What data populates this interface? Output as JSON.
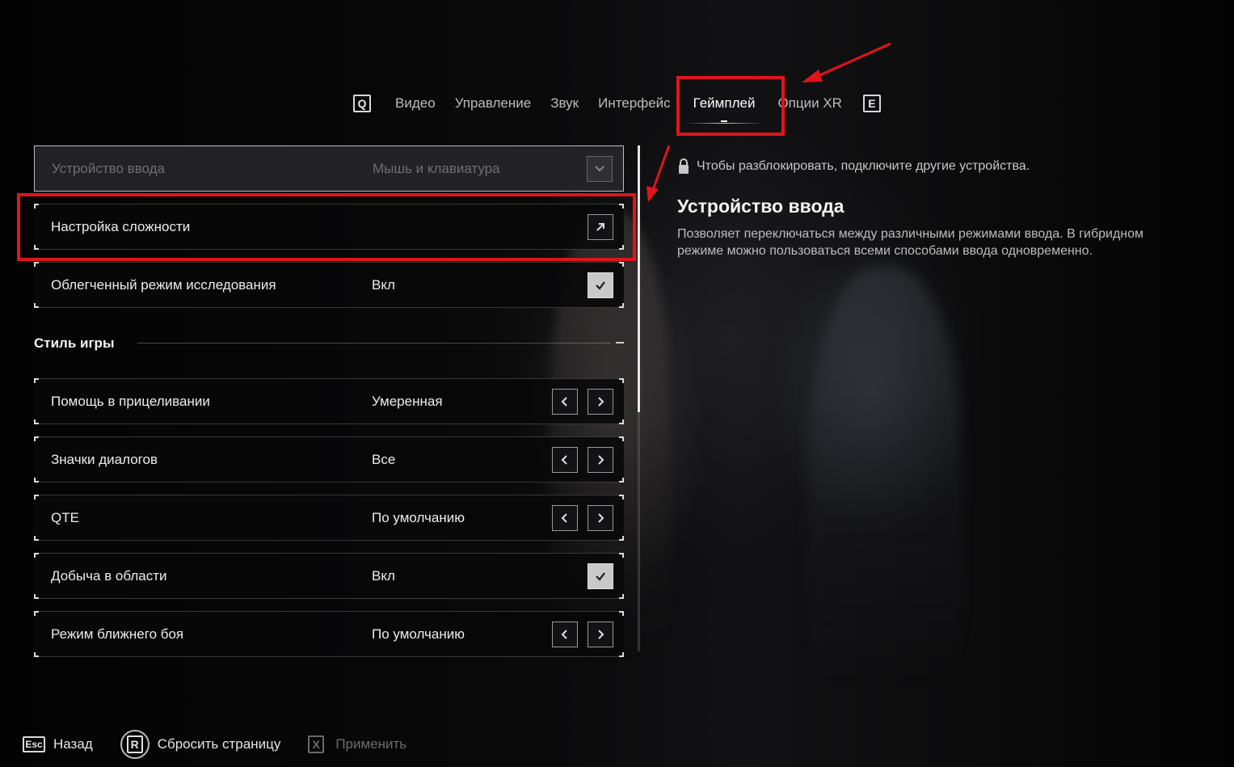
{
  "tabs": {
    "prev_key": "Q",
    "next_key": "E",
    "items": [
      {
        "label": "Видео"
      },
      {
        "label": "Управление"
      },
      {
        "label": "Звук"
      },
      {
        "label": "Интерфейс"
      },
      {
        "label": "Геймплей",
        "active": true
      },
      {
        "label": "Опции XR"
      }
    ]
  },
  "settings": {
    "input_device": {
      "label": "Устройство ввода",
      "value": "Мышь и клавиатура",
      "control": "dropdown",
      "locked": true
    },
    "difficulty": {
      "label": "Настройка сложности",
      "control": "link"
    },
    "easy_exploration": {
      "label": "Облегченный режим исследования",
      "value": "Вкл",
      "control": "checkbox",
      "checked": true
    },
    "section_title": "Стиль игры",
    "aim_assist": {
      "label": "Помощь в прицеливании",
      "value": "Умеренная",
      "control": "stepper"
    },
    "dialog_icons": {
      "label": "Значки диалогов",
      "value": "Все",
      "control": "stepper"
    },
    "qte": {
      "label": "QTE",
      "value": "По умолчанию",
      "control": "stepper"
    },
    "area_loot": {
      "label": "Добыча в области",
      "value": "Вкл",
      "control": "checkbox",
      "checked": true
    },
    "melee_mode": {
      "label": "Режим ближнего боя",
      "value": "По умолчанию",
      "control": "stepper"
    }
  },
  "info": {
    "lock_text": "Чтобы разблокировать, подключите другие устройства.",
    "title": "Устройство ввода",
    "description": "Позволяет переключаться между различными режимами ввода. В гибридном режиме можно пользоваться всеми способами ввода одновременно."
  },
  "footer": {
    "back": {
      "key": "Esc",
      "label": "Назад"
    },
    "reset": {
      "key": "R",
      "label": "Сбросить страницу"
    },
    "apply": {
      "key": "X",
      "label": "Применить",
      "disabled": true
    }
  },
  "colors": {
    "annotation": "#e0141b",
    "background": "#000000",
    "text": "#ececec",
    "muted": "#6f6f6f"
  },
  "icons": [
    "chevron-down-icon",
    "external-arrow-icon",
    "check-icon",
    "chevron-left-icon",
    "chevron-right-icon",
    "lock-icon"
  ]
}
